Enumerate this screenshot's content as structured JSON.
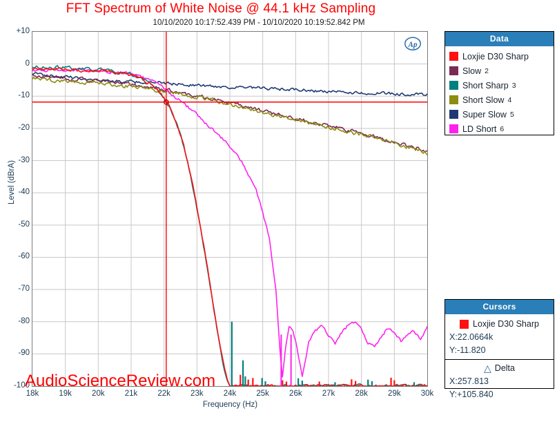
{
  "header": {
    "title": "FFT Spectrum of White Noise @ 44.1 kHz Sampling",
    "timestamp": "10/10/2020 10:17:52.439 PM - 10/10/2020 10:19:52.842 PM",
    "title_color": "#ff0000",
    "logo": "ap-logo"
  },
  "watermark": {
    "text": "AudioScienceReview.com",
    "color": "#ff0000"
  },
  "legend": {
    "header": "Data",
    "items": [
      {
        "label": "Loxjie D30 Sharp",
        "num": "",
        "color": "#ff1111"
      },
      {
        "label": "Slow",
        "num": "2",
        "color": "#7b2a55"
      },
      {
        "label": "Short Sharp",
        "num": "3",
        "color": "#00807f"
      },
      {
        "label": "Short Slow",
        "num": "4",
        "color": "#8c8c10"
      },
      {
        "label": "Super Slow",
        "num": "5",
        "color": "#1f3a73"
      },
      {
        "label": "LD Short",
        "num": "6",
        "color": "#ff22ee"
      }
    ]
  },
  "cursors": {
    "header": "Cursors",
    "trace_label": "Loxjie D30 Sharp",
    "trace_color": "#ff1111",
    "x_label": "X:22.0664k",
    "y_label": "Y:-11.820",
    "delta_label": "Delta",
    "delta_symbol": "△",
    "delta_x": "X:257.813",
    "delta_y": "Y:+105.840"
  },
  "chart_data": {
    "type": "line",
    "title": "FFT Spectrum of White Noise @ 44.1 kHz Sampling",
    "subtitle": "10/10/2020 10:17:52.439 PM - 10/10/2020 10:19:52.842 PM",
    "xlabel": "Frequency (Hz)",
    "ylabel": "Level (dBrA)",
    "xlim": [
      18000,
      30000
    ],
    "ylim": [
      -100,
      10
    ],
    "xticks": [
      18000,
      19000,
      20000,
      21000,
      22000,
      23000,
      24000,
      25000,
      26000,
      27000,
      28000,
      29000,
      30000
    ],
    "xtick_labels": [
      "18k",
      "19k",
      "20k",
      "21k",
      "22k",
      "23k",
      "24k",
      "25k",
      "26k",
      "27k",
      "28k",
      "29k",
      "30k"
    ],
    "yticks": [
      10,
      0,
      -10,
      -20,
      -30,
      -40,
      -50,
      -60,
      -70,
      -80,
      -90,
      -100
    ],
    "ytick_labels": [
      "+10",
      "0",
      "-10",
      "-20",
      "-30",
      "-40",
      "-50",
      "-60",
      "-70",
      "-80",
      "-90",
      "-100"
    ],
    "grid": true,
    "xscale": "linear",
    "legend_position": "right",
    "cursor_lines": {
      "x": 22066.4,
      "y": -11.82,
      "color": "#ff0000"
    },
    "series": [
      {
        "name": "Loxjie D30 Sharp",
        "color": "#ff1111",
        "x": [
          18000,
          18500,
          19000,
          19500,
          20000,
          20500,
          21000,
          21300,
          21600,
          21900,
          22000,
          22100,
          22200,
          22300,
          22400,
          22500,
          22600,
          22700,
          22800,
          22900,
          23000,
          23100,
          23200,
          23300,
          23400,
          23500,
          23600,
          23700,
          23800,
          23900,
          23980,
          24050,
          24100
        ],
        "y": [
          -1.5,
          -1.8,
          -1.6,
          -2.2,
          -2.0,
          -2.6,
          -3.4,
          -4.6,
          -6.4,
          -9.4,
          -10.6,
          -12.0,
          -14.0,
          -16.3,
          -19.0,
          -22.0,
          -25.5,
          -29.5,
          -34.0,
          -39.0,
          -44.5,
          -50.0,
          -56.0,
          -62.0,
          -68.5,
          -75.0,
          -81.5,
          -87.5,
          -93.0,
          -97.5,
          -100,
          -100,
          -100
        ]
      },
      {
        "name": "Slow",
        "color": "#7b2a55",
        "x": [
          18000,
          19000,
          20000,
          21000,
          22000,
          23000,
          24000,
          25000,
          26000,
          27000,
          28000,
          29000,
          30000
        ],
        "y": [
          -3.6,
          -4.4,
          -5.3,
          -6.4,
          -8.0,
          -9.8,
          -12.0,
          -14.6,
          -16.8,
          -19.2,
          -21.6,
          -24.2,
          -27.0
        ]
      },
      {
        "name": "Short Sharp",
        "color": "#00807f",
        "x": [
          18000,
          18500,
          19000,
          19500,
          20000,
          20500,
          21000,
          21300,
          21600,
          21900,
          22000,
          22100,
          22200,
          22300,
          22400,
          22500,
          22600,
          22700,
          22800,
          22900,
          23000,
          23100,
          23200,
          23300,
          23400,
          23500,
          23600,
          23700,
          23800,
          23900,
          23980,
          24050,
          24100
        ],
        "y": [
          -0.8,
          -1.2,
          -1.0,
          -1.6,
          -1.7,
          -2.4,
          -3.2,
          -4.4,
          -6.2,
          -9.2,
          -10.5,
          -12.2,
          -14.2,
          -16.6,
          -19.3,
          -22.3,
          -25.8,
          -29.8,
          -34.3,
          -39.3,
          -44.8,
          -50.3,
          -56.3,
          -62.3,
          -68.8,
          -75.3,
          -81.8,
          -87.8,
          -93.3,
          -97.8,
          -100,
          -100,
          -100
        ]
      },
      {
        "name": "Short Slow",
        "color": "#8c8c10",
        "x": [
          18000,
          19000,
          20000,
          21000,
          22000,
          23000,
          24000,
          25000,
          26000,
          27000,
          28000,
          29000,
          30000
        ],
        "y": [
          -4.6,
          -5.2,
          -6.0,
          -7.0,
          -8.4,
          -10.2,
          -12.4,
          -15.0,
          -17.2,
          -19.6,
          -22.0,
          -24.6,
          -27.6
        ]
      },
      {
        "name": "Super Slow",
        "color": "#1f3a73",
        "x": [
          18000,
          19000,
          20000,
          21000,
          22000,
          23000,
          24000,
          25000,
          26000,
          27000,
          28000,
          29000,
          30000
        ],
        "y": [
          -3.0,
          -4.0,
          -5.0,
          -5.6,
          -6.0,
          -6.6,
          -7.2,
          -7.6,
          -8.0,
          -8.6,
          -9.0,
          -9.2,
          -9.6
        ]
      },
      {
        "name": "LD Short",
        "color": "#ff22ee",
        "x": [
          18000,
          19000,
          20000,
          21000,
          21600,
          22000,
          22400,
          22800,
          23200,
          23600,
          24000,
          24400,
          24800,
          25200,
          25400,
          25500,
          25600,
          25700,
          25800,
          25900,
          26000,
          26200,
          26400,
          26600,
          26800,
          27000,
          27200,
          27400,
          27600,
          27800,
          28000,
          28200,
          28400,
          28600,
          28800,
          29000,
          29200,
          29400,
          29600,
          29800,
          30000
        ],
        "y": [
          -1.8,
          -2.0,
          -2.2,
          -2.8,
          -5.0,
          -7.4,
          -10.6,
          -14.0,
          -17.6,
          -21.4,
          -25.6,
          -31.0,
          -39.0,
          -54.0,
          -70.0,
          -86.0,
          -97.5,
          -88.0,
          -81.5,
          -82.0,
          -86.0,
          -97.0,
          -86.5,
          -83.0,
          -81.0,
          -84.0,
          -86.5,
          -83.5,
          -81.0,
          -80.5,
          -82.0,
          -86.5,
          -88.0,
          -84.5,
          -82.0,
          -83.5,
          -86.0,
          -84.5,
          -83.0,
          -86.0,
          -81.5
        ]
      }
    ]
  }
}
